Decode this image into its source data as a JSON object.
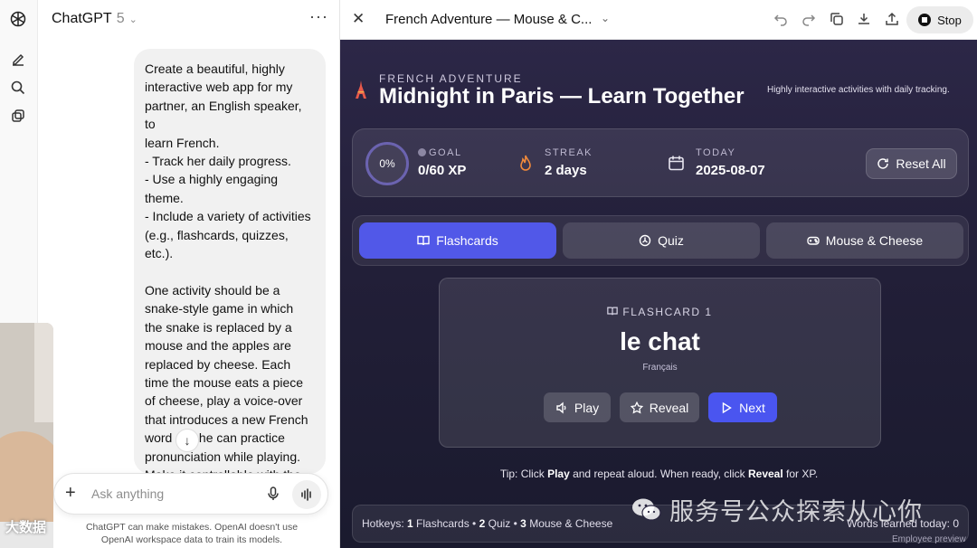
{
  "chat": {
    "app_title": "ChatGPT",
    "version": "5",
    "message": "Create a beautiful, highly\ninteractive web app for my\npartner, an English speaker, to\nlearn French.\n- Track her daily progress.\n- Use a highly engaging\ntheme.\n- Include a variety of activities\n(e.g., flashcards, quizzes,\netc.).\n\nOne activity should be a\nsnake-style game in which\nthe snake is replaced by a\nmouse and the apples are\nreplaced by cheese. Each\ntime the mouse eats a piece\nof cheese, play a voice-over\nthat introduces a new French\nword so she can practice\npronunciation while playing.\nMake it controllable with the\narrow keys.",
    "composer_placeholder": "Ask anything",
    "disclaimer": "ChatGPT can make mistakes. OpenAI doesn't use OpenAI workspace data to train its models."
  },
  "canvas": {
    "doc_title": "French Adventure — Mouse & C...",
    "stop_label": "Stop"
  },
  "app": {
    "eyebrow": "FRENCH ADVENTURE",
    "title": "Midnight in Paris — Learn Together",
    "tagline": "Highly interactive activities with daily tracking.",
    "progress_percent": "0%",
    "goal_label": "GOAL",
    "goal_value": "0/60 XP",
    "streak_label": "STREAK",
    "streak_value": "2 days",
    "today_label": "TODAY",
    "today_value": "2025-08-07",
    "reset_label": "Reset All",
    "tabs": [
      {
        "label": "Flashcards",
        "icon": "book-icon",
        "active": true
      },
      {
        "label": "Quiz",
        "icon": "quiz-icon",
        "active": false
      },
      {
        "label": "Mouse & Cheese",
        "icon": "gamepad-icon",
        "active": false
      }
    ],
    "card": {
      "eyebrow": "FLASHCARD 1",
      "word": "le chat",
      "language": "Français",
      "play": "Play",
      "reveal": "Reveal",
      "next": "Next"
    },
    "tip": {
      "prefix": "Tip: Click ",
      "play": "Play",
      "middle": " and repeat aloud. When ready, click ",
      "reveal": "Reveal",
      "suffix": " for XP."
    },
    "hotkeys": {
      "prefix": "Hotkeys: ",
      "k1": "1",
      "t1": " Flashcards • ",
      "k2": "2",
      "t2": " Quiz • ",
      "k3": "3",
      "t3": " Mouse & Cheese"
    },
    "words_learned": "Words learned today: 0",
    "employee_preview": "Employee preview"
  },
  "overlay": {
    "watermark": "服务号公众探索从心你",
    "watermark_left": "大数据"
  },
  "colors": {
    "accent": "#5158e8",
    "app_bg": "#221f38",
    "flame": "#f08a3c"
  }
}
